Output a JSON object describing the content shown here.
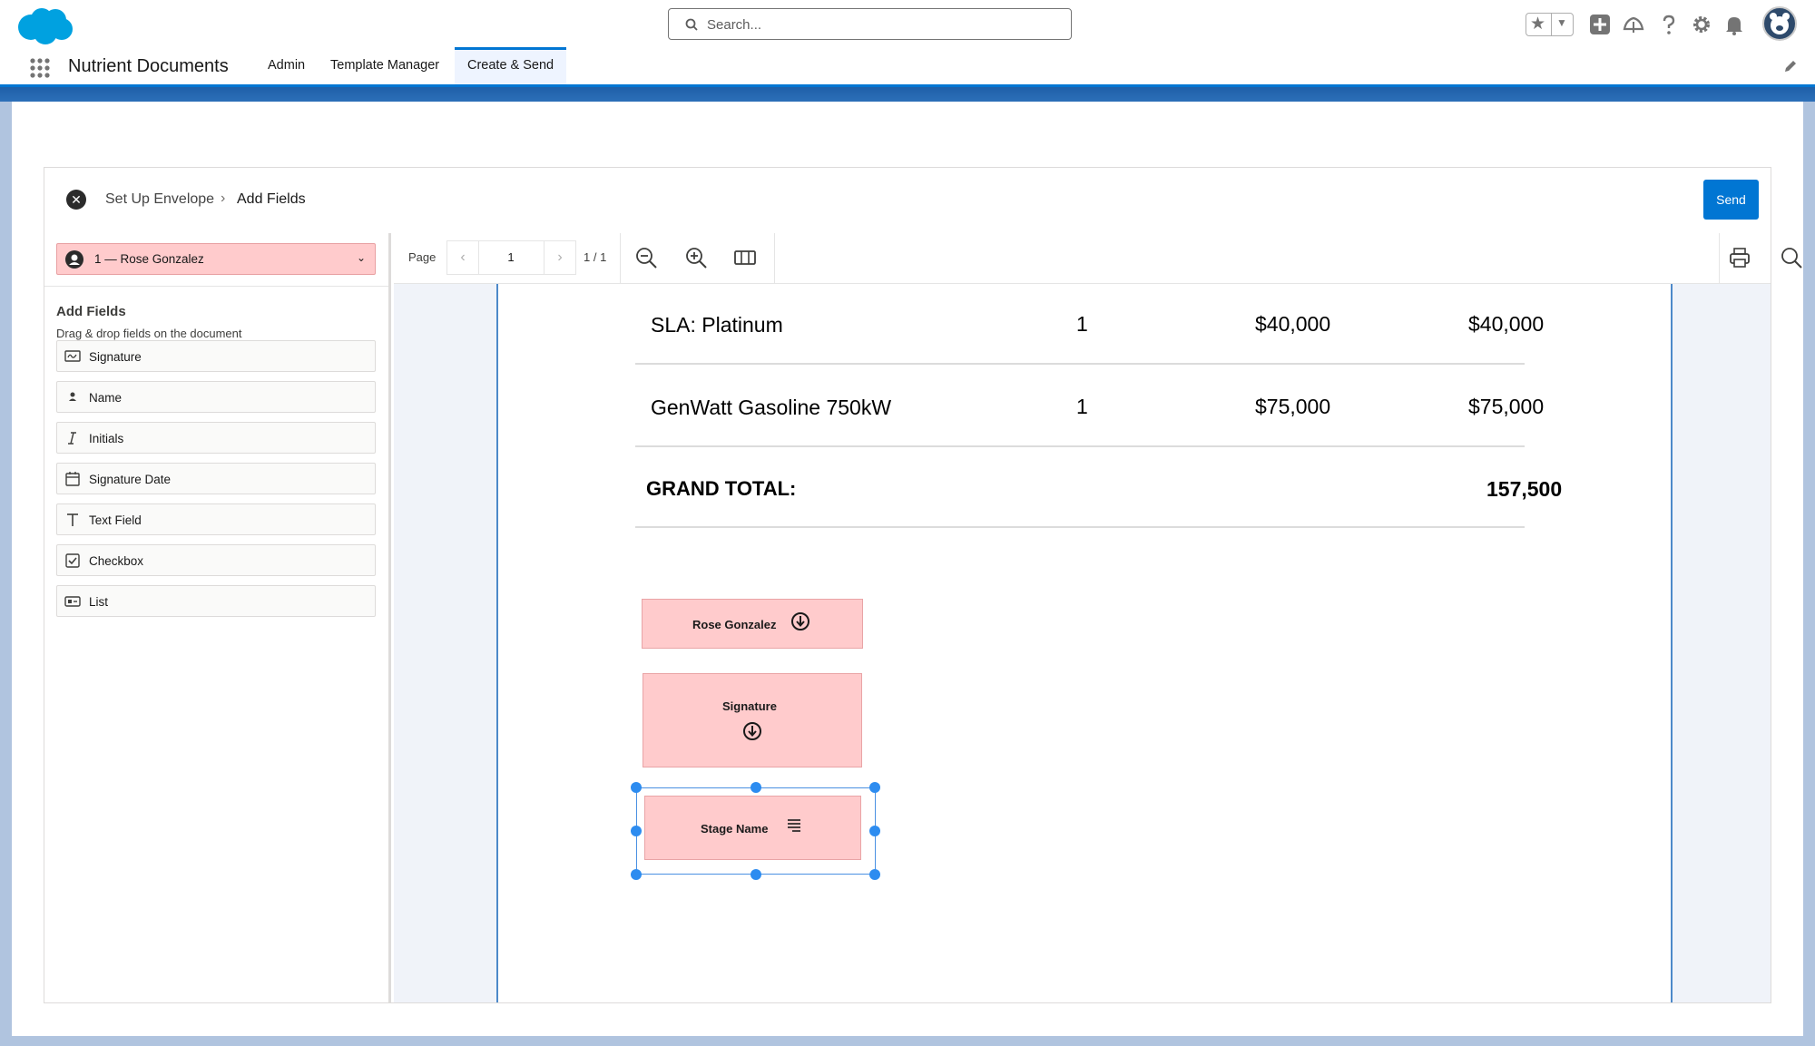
{
  "header": {
    "search": {
      "placeholder": "Search..."
    }
  },
  "nav": {
    "app_name": "Nutrient Documents",
    "tabs": [
      {
        "label": "Admin"
      },
      {
        "label": "Template Manager"
      },
      {
        "label": "Create & Send"
      }
    ],
    "active_tab": "Create & Send"
  },
  "envelope": {
    "breadcrumb": [
      {
        "label": "Set Up Envelope"
      },
      {
        "label": "Add Fields"
      }
    ],
    "send_label": "Send"
  },
  "sidebar": {
    "recipient": "1 — Rose Gonzalez",
    "title": "Add Fields",
    "subtitle": "Drag & drop fields on the document",
    "fields": [
      {
        "label": "Signature",
        "icon": "signature-icon"
      },
      {
        "label": "Name",
        "icon": "person-icon"
      },
      {
        "label": "Initials",
        "icon": "italic-i-icon"
      },
      {
        "label": "Signature Date",
        "icon": "calendar-icon"
      },
      {
        "label": "Text Field",
        "icon": "text-t-icon"
      },
      {
        "label": "Checkbox",
        "icon": "checkbox-icon"
      },
      {
        "label": "List",
        "icon": "list-icon"
      }
    ]
  },
  "toolbar": {
    "page_label": "Page",
    "page_value": "1",
    "page_count": "1 / 1"
  },
  "document": {
    "rows": [
      {
        "item": "SLA: Platinum",
        "qty": "1",
        "price": "$40,000",
        "total": "$40,000"
      },
      {
        "item": "GenWatt Gasoline 750kW",
        "qty": "1",
        "price": "$75,000",
        "total": "$75,000"
      }
    ],
    "grand_total_label": "GRAND TOTAL:",
    "grand_total_value": "157,500",
    "placed_fields": [
      {
        "label": "Rose Gonzalez"
      },
      {
        "label": "Signature"
      },
      {
        "label": "Stage Name"
      }
    ]
  },
  "colors": {
    "brand_blue": "#0176d3",
    "field_fill": "#ffcbcc",
    "selection_blue": "#2d8cf0"
  }
}
